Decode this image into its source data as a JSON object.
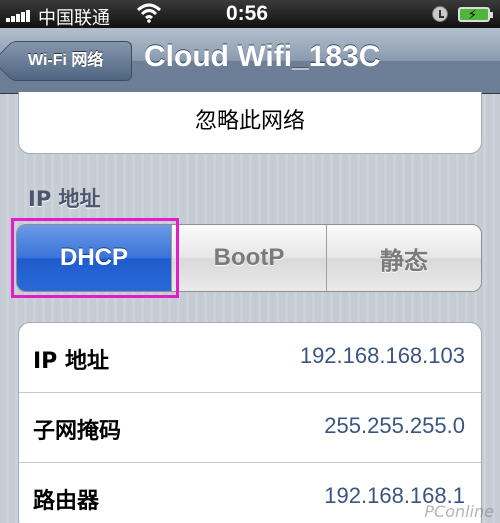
{
  "status_bar": {
    "carrier": "中国联通",
    "time": "0:56",
    "icons": [
      "signal-icon",
      "wifi-icon",
      "alarm-icon",
      "battery-icon"
    ]
  },
  "nav": {
    "back_label": "Wi-Fi 网络",
    "title": "Cloud Wifi_183C"
  },
  "forget_network": "忽略此网络",
  "ip_section": {
    "header": "IP 地址",
    "segments": [
      {
        "label": "DHCP",
        "selected": true
      },
      {
        "label": "BootP",
        "selected": false
      },
      {
        "label": "静态",
        "selected": false
      }
    ]
  },
  "info_rows": [
    {
      "label": "IP 地址",
      "value": "192.168.168.103"
    },
    {
      "label": "子网掩码",
      "value": "255.255.255.0"
    },
    {
      "label": "路由器",
      "value": "192.168.168.1"
    }
  ],
  "watermark": "PConline",
  "colors": {
    "nav_bar": "#6d7f97",
    "selected_segment": "#2b69d8",
    "highlight": "#e21ec8",
    "value_text": "#3b5583"
  }
}
